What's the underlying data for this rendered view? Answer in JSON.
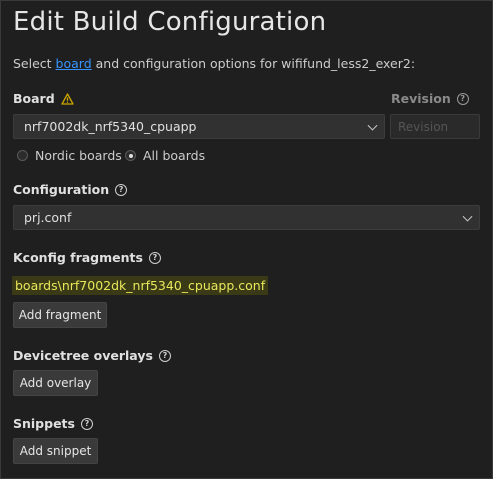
{
  "page": {
    "title": "Edit Build Configuration",
    "subtitle_before": "Select ",
    "subtitle_link": "board",
    "subtitle_after": " and configuration options for wififund_less2_exer2:"
  },
  "board": {
    "label": "Board",
    "value": "nrf7002dk_nrf5340_cpuapp",
    "warning_icon": "warning-triangle-icon"
  },
  "revision": {
    "label": "Revision",
    "placeholder": "Revision"
  },
  "board_filter": {
    "options": [
      "Nordic boards",
      "All boards"
    ],
    "selected": "All boards"
  },
  "configuration": {
    "label": "Configuration",
    "value": "prj.conf"
  },
  "kconfig": {
    "label": "Kconfig fragments",
    "fragments": [
      "boards\\nrf7002dk_nrf5340_cpuapp.conf"
    ],
    "add_label": "Add fragment"
  },
  "devicetree": {
    "label": "Devicetree overlays",
    "add_label": "Add overlay"
  },
  "snippets": {
    "label": "Snippets",
    "add_label": "Add snippet"
  },
  "colors": {
    "background": "#1f1f1f",
    "link": "#3794ff",
    "warning": "#cca700",
    "highlight": "#e8e85a"
  }
}
